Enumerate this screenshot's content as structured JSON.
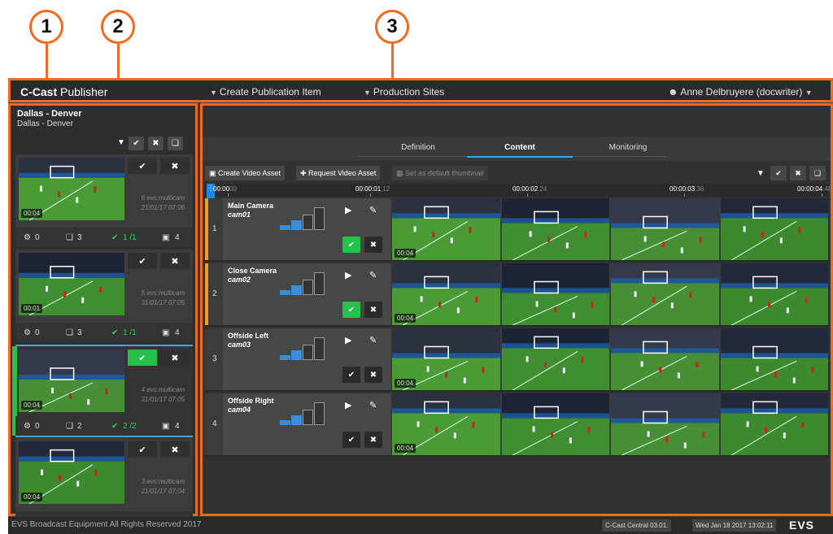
{
  "callouts": [
    "1",
    "2",
    "3"
  ],
  "topbar": {
    "logo_bold": "C-Cast",
    "logo_light": " Publisher",
    "menu_create": "Create Publication Item",
    "menu_sites": "Production Sites",
    "user": "Anne Delbruyere (docwriter)"
  },
  "left_panel": {
    "title": "Dallas - Denver",
    "subtitle": "Dallas - Denver",
    "cards": [
      {
        "duration": "00:04",
        "cams": "6 evs:multicam",
        "date": "21/01/17 07:06",
        "s1": "0",
        "s2": "3",
        "s3": "1 /1",
        "s4": "4",
        "selected": false
      },
      {
        "duration": "00:01",
        "cams": "5 evs:multicam",
        "date": "31/01/17 07:05",
        "s1": "0",
        "s2": "3",
        "s3": "1 /1",
        "s4": "4",
        "selected": false
      },
      {
        "duration": "00:04",
        "cams": "4 evs:multicam",
        "date": "31/01/17 07:05",
        "s1": "0",
        "s2": "2",
        "s3": "2 /2",
        "s4": "4",
        "selected": true
      },
      {
        "duration": "00:04",
        "cams": "3 evs:multicam",
        "date": "21/01/17 07:04",
        "s1": "0",
        "s2": "3",
        "s3": "1 /1",
        "s4": "4",
        "selected": false
      }
    ]
  },
  "main": {
    "tabs": [
      "Definition",
      "Content",
      "Monitoring"
    ],
    "toolbar": {
      "create_video_asset": "Create Video Asset",
      "request_video_asset": "Request Video Asset",
      "set_default_thumbnail": "Set as default thumbnail"
    },
    "timeline": [
      {
        "t": "00:00",
        "f": "00"
      },
      {
        "t": "00:00:01",
        "f": ".12"
      },
      {
        "t": "00:00:02",
        "f": ".24"
      },
      {
        "t": "00:00:03",
        "f": ".36"
      },
      {
        "t": "00:00:04",
        "f": ".48"
      }
    ],
    "rows": [
      {
        "num": "1",
        "name": "Main Camera",
        "cam": "cam01",
        "duration": "00:04",
        "validated": true
      },
      {
        "num": "2",
        "name": "Close Camera",
        "cam": "cam02",
        "duration": "00:04",
        "validated": true
      },
      {
        "num": "3",
        "name": "Offside Left",
        "cam": "cam03",
        "duration": "00:04",
        "validated": false
      },
      {
        "num": "4",
        "name": "Offside Right",
        "cam": "cam04",
        "duration": "00:04",
        "validated": false
      }
    ]
  },
  "footer": {
    "copyright": "EVS Broadcast Equipment All Rights Reserved 2017",
    "server": "C-Cast Central 03.01.",
    "datetime": "Wed Jan 18 2017 13:02:11",
    "brand": "EVS"
  },
  "colors": {
    "accent_orange": "#f26a1b",
    "validated_green": "#25c14a",
    "tab_blue": "#3fa8e0",
    "row_bar": "#f0a020"
  }
}
